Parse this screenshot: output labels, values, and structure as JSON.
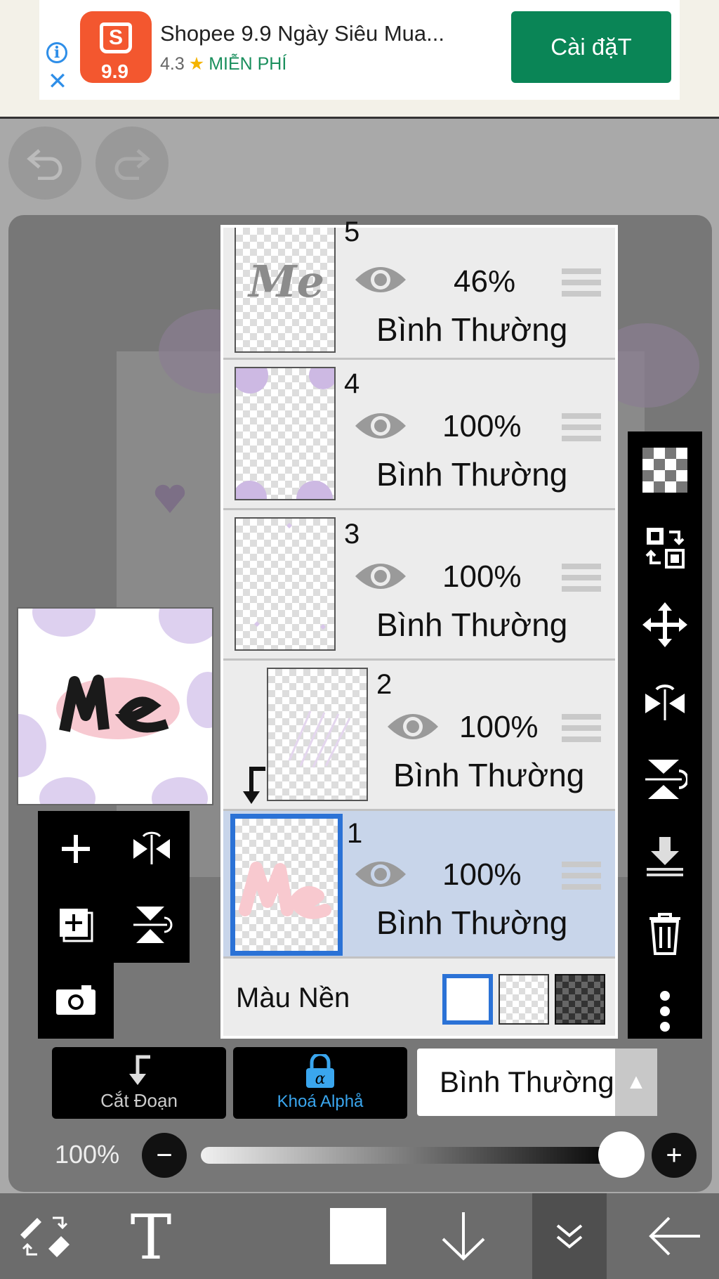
{
  "ad": {
    "title": "Shopee 9.9 Ngày Siêu Mua...",
    "rating": "4.3",
    "price_label": "MIỄN PHÍ",
    "install_label": "Cài đặT",
    "logo_text": "9.9"
  },
  "layers": [
    {
      "number": "5",
      "opacity": "46%",
      "blend": "Bình Thường",
      "selected": false
    },
    {
      "number": "4",
      "opacity": "100%",
      "blend": "Bình Thường",
      "selected": false
    },
    {
      "number": "3",
      "opacity": "100%",
      "blend": "Bình Thường",
      "selected": false
    },
    {
      "number": "2",
      "opacity": "100%",
      "blend": "Bình Thường",
      "selected": false,
      "clipped": true
    },
    {
      "number": "1",
      "opacity": "100%",
      "blend": "Bình Thường",
      "selected": true
    }
  ],
  "background_color": {
    "label": "Màu Nền"
  },
  "controls": {
    "clipping_label": "Cắt Đoạn",
    "alpha_lock_label": "Khoá Alphå",
    "blend_mode": "Bình Thường",
    "zoom": "100%"
  },
  "icons": {
    "undo": "undo-icon",
    "redo": "redo-icon",
    "eye": "eye-icon",
    "trash": "trash-icon",
    "move": "move-icon"
  },
  "colors": {
    "install_green": "#0a8556",
    "selected_layer": "#c8d5ea",
    "selection_border": "#2b72d6",
    "alpha_lock_blue": "#3aa6ee"
  }
}
